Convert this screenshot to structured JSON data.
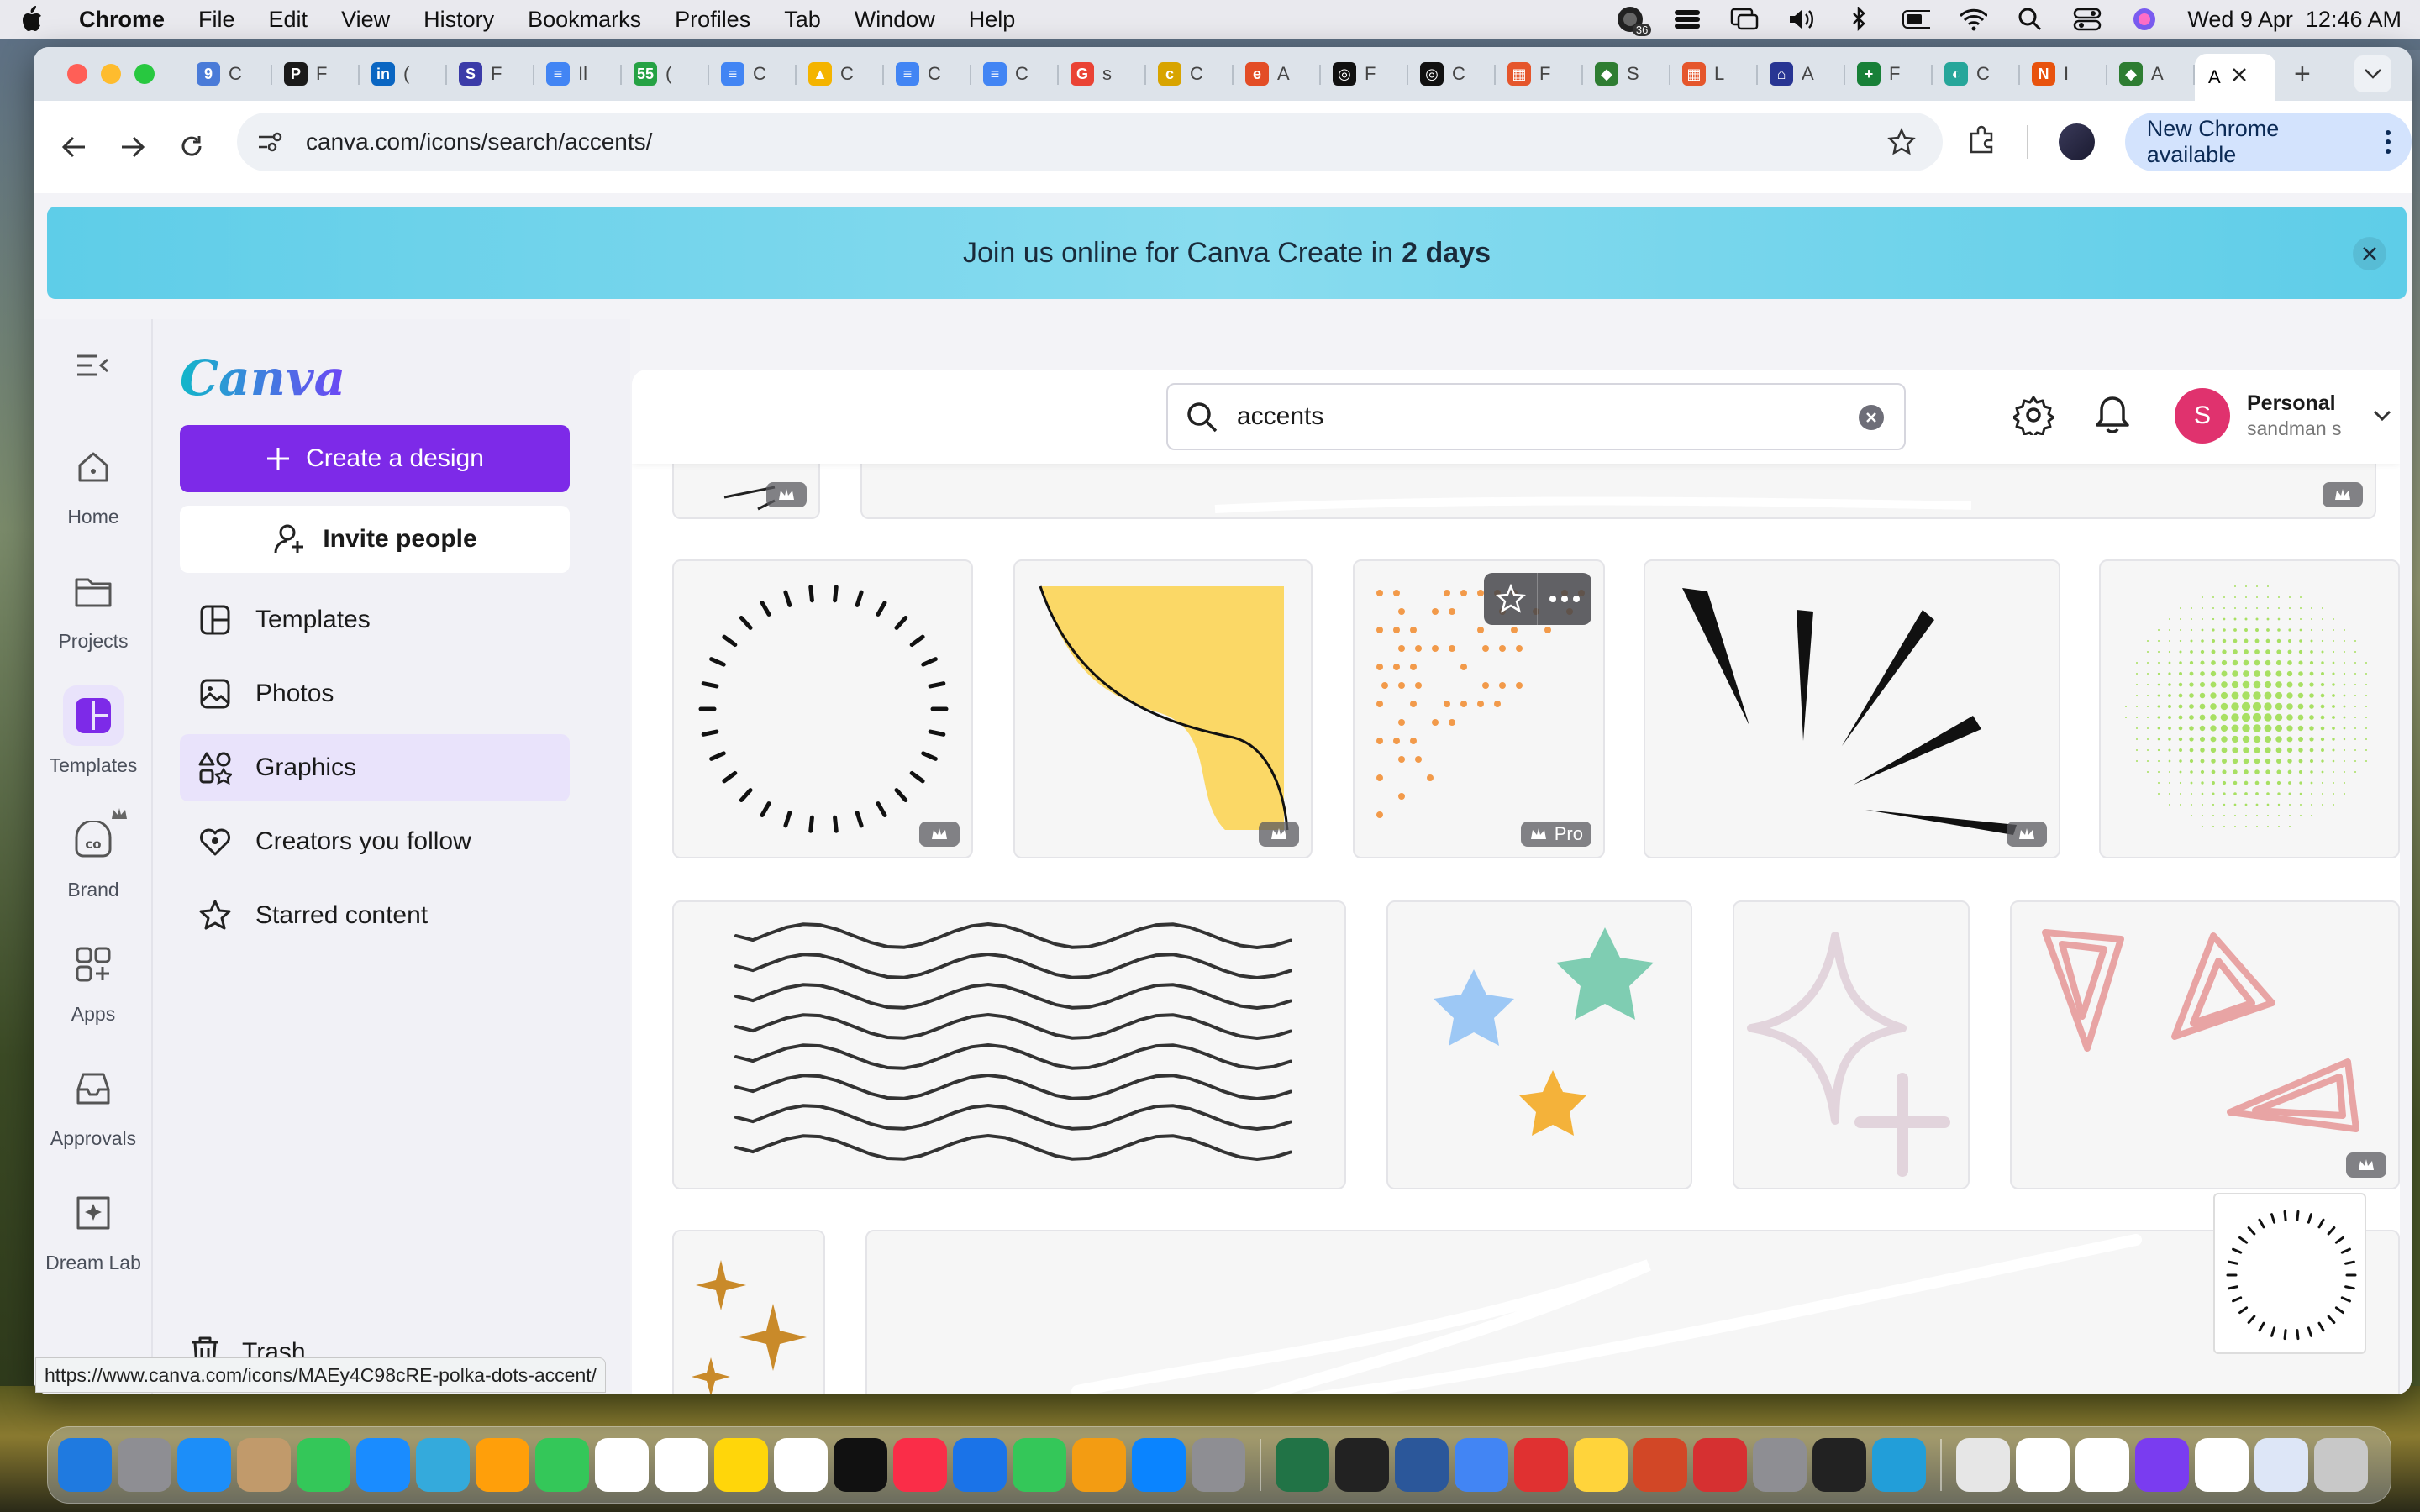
{
  "menubar": {
    "app_name": "Chrome",
    "menus": [
      "File",
      "Edit",
      "View",
      "History",
      "Bookmarks",
      "Profiles",
      "Tab",
      "Window",
      "Help"
    ],
    "datetime": "Wed 9 Apr  12:46 AM",
    "notification_badge": "36"
  },
  "browser": {
    "url": "canva.com/icons/search/accents/",
    "update_label": "New Chrome available",
    "tabs": [
      {
        "fav": "9",
        "color": "#4a7bd8",
        "text": "C"
      },
      {
        "fav": "P",
        "color": "#1a1a1a",
        "text": "F"
      },
      {
        "fav": "in",
        "color": "#0a66c2",
        "text": "("
      },
      {
        "fav": "S",
        "color": "#3b3ba8",
        "text": "F"
      },
      {
        "fav": "≡",
        "color": "#4285f4",
        "text": "Il"
      },
      {
        "fav": "55",
        "color": "#25a244",
        "text": "("
      },
      {
        "fav": "≡",
        "color": "#4285f4",
        "text": "C"
      },
      {
        "fav": "▲",
        "color": "#f4b400",
        "text": "C"
      },
      {
        "fav": "≡",
        "color": "#4285f4",
        "text": "C"
      },
      {
        "fav": "≡",
        "color": "#4285f4",
        "text": "C"
      },
      {
        "fav": "G",
        "color": "#ea4335",
        "text": "s"
      },
      {
        "fav": "c",
        "color": "#d8a400",
        "text": "C"
      },
      {
        "fav": "e",
        "color": "#e34d26",
        "text": "A"
      },
      {
        "fav": "◎",
        "color": "#111111",
        "text": "F"
      },
      {
        "fav": "◎",
        "color": "#111111",
        "text": "C"
      },
      {
        "fav": "▦",
        "color": "#e5562c",
        "text": "F"
      },
      {
        "fav": "◆",
        "color": "#2e7d32",
        "text": "S"
      },
      {
        "fav": "▦",
        "color": "#e5562c",
        "text": "L"
      },
      {
        "fav": "⌂",
        "color": "#283593",
        "text": "A"
      },
      {
        "fav": "+",
        "color": "#188038",
        "text": "F"
      },
      {
        "fav": "◐",
        "color": "#26a69a",
        "text": "C"
      },
      {
        "fav": "N",
        "color": "#e8530e",
        "text": "I"
      },
      {
        "fav": "◆",
        "color": "#2e7d32",
        "text": "A"
      }
    ],
    "active_tab_text": "A"
  },
  "banner": {
    "text": "Join us online for Canva Create in",
    "highlight": "2 days"
  },
  "rail": {
    "items": [
      {
        "label": "Home",
        "icon": "home-icon"
      },
      {
        "label": "Projects",
        "icon": "folder-icon"
      },
      {
        "label": "Templates",
        "icon": "templates-icon"
      },
      {
        "label": "Brand",
        "icon": "brand-icon"
      },
      {
        "label": "Apps",
        "icon": "apps-icon"
      },
      {
        "label": "Approvals",
        "icon": "inbox-icon"
      },
      {
        "label": "Dream Lab",
        "icon": "dreamlab-icon"
      }
    ]
  },
  "sidebar": {
    "logo": "Canva",
    "create_label": "Create a design",
    "invite_label": "Invite people",
    "links": [
      {
        "label": "Templates"
      },
      {
        "label": "Photos"
      },
      {
        "label": "Graphics"
      },
      {
        "label": "Creators you follow"
      },
      {
        "label": "Starred content"
      }
    ],
    "trash_label": "Trash"
  },
  "topbar": {
    "search_value": "accents",
    "account_name": "Personal",
    "account_sub": "sandman s",
    "avatar_letter": "S"
  },
  "results": {
    "pro_label": "Pro"
  },
  "status_url": "https://www.canva.com/icons/MAEy4C98cRE-polka-dots-accent/",
  "colors": {
    "accent": "#7d2ae8",
    "banner": "#5ecde8",
    "avatar": "#e0326e"
  }
}
